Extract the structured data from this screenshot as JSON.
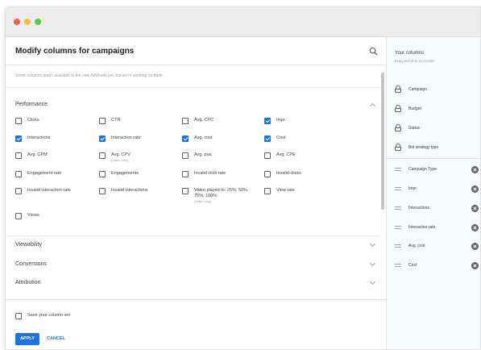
{
  "window": {
    "dot_colors": [
      "#f25f58",
      "#fbbe2e",
      "#58cb42"
    ]
  },
  "header": {
    "title": "Modify columns for campaigns"
  },
  "notice": "Some columns aren't available in the new AdWords yet, but we're working on them.",
  "performance": {
    "title": "Performance",
    "items": [
      {
        "label": "Clicks",
        "checked": false
      },
      {
        "label": "CTR",
        "checked": false
      },
      {
        "label": "Avg. CPC",
        "checked": false
      },
      {
        "label": "Impr.",
        "checked": true
      },
      {
        "label": "Interactions",
        "checked": true
      },
      {
        "label": "Interaction rate",
        "checked": true
      },
      {
        "label": "Avg. cost",
        "checked": true
      },
      {
        "label": "Cost",
        "checked": true
      },
      {
        "label": "Avg. CPM",
        "checked": false
      },
      {
        "label": "Avg. CPV",
        "sub": "(Video only)",
        "checked": false
      },
      {
        "label": "Avg. pos.",
        "checked": false
      },
      {
        "label": "Avg. CPE",
        "checked": false
      },
      {
        "label": "Engagement rate",
        "checked": false
      },
      {
        "label": "Engagements",
        "checked": false
      },
      {
        "label": "Invalid click rate",
        "checked": false
      },
      {
        "label": "Invalid clicks",
        "checked": false
      },
      {
        "label": "Invalid interaction rate",
        "checked": false
      },
      {
        "label": "Invalid interactions",
        "checked": false
      },
      {
        "label": "Video played to: 25%, 50%, 75%, 100%",
        "sub": "(Video only)",
        "checked": false
      },
      {
        "label": "View rate",
        "checked": false
      },
      {
        "label": "Views",
        "checked": false
      }
    ]
  },
  "sections": [
    {
      "title": "Viewability"
    },
    {
      "title": "Conversions"
    },
    {
      "title": "Attribution"
    }
  ],
  "footer": {
    "save_label": "Save your column set",
    "apply_label": "APPLY",
    "cancel_label": "CANCEL"
  },
  "your_columns": {
    "title": "Your columns",
    "subtitle": "Drag and drop to reorder",
    "locked": [
      "Campaign",
      "Budget",
      "Status",
      "Bid strategy type"
    ],
    "movable": [
      "Campaign Type",
      "Impr.",
      "Interactions",
      "Interaction rate",
      "Avg. cost",
      "Cost"
    ]
  },
  "colors": {
    "accent": "#1a73e8"
  }
}
